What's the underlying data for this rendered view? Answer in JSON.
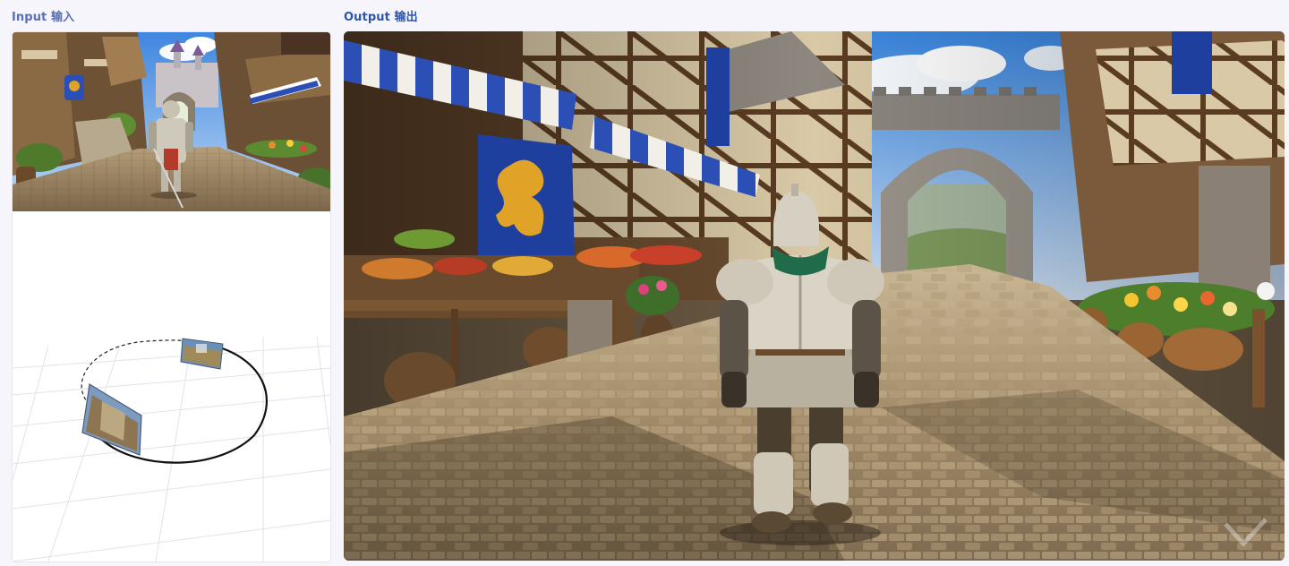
{
  "input_panel": {
    "label": "Input 输入"
  },
  "output_panel": {
    "label": "Output 输出"
  },
  "scene": {
    "sky_color": "#5b9ee8",
    "stone_color": "#a08a6a",
    "awning_blue": "#2c4fb5",
    "banner_blue": "#1f3f9e",
    "banner_emblem": "#e0a227",
    "armor_color": "#d9d4c6",
    "scarf_color": "#1f6b4a"
  },
  "trajectory": {
    "icons": [
      "camera-frame-start",
      "camera-frame-end"
    ]
  }
}
